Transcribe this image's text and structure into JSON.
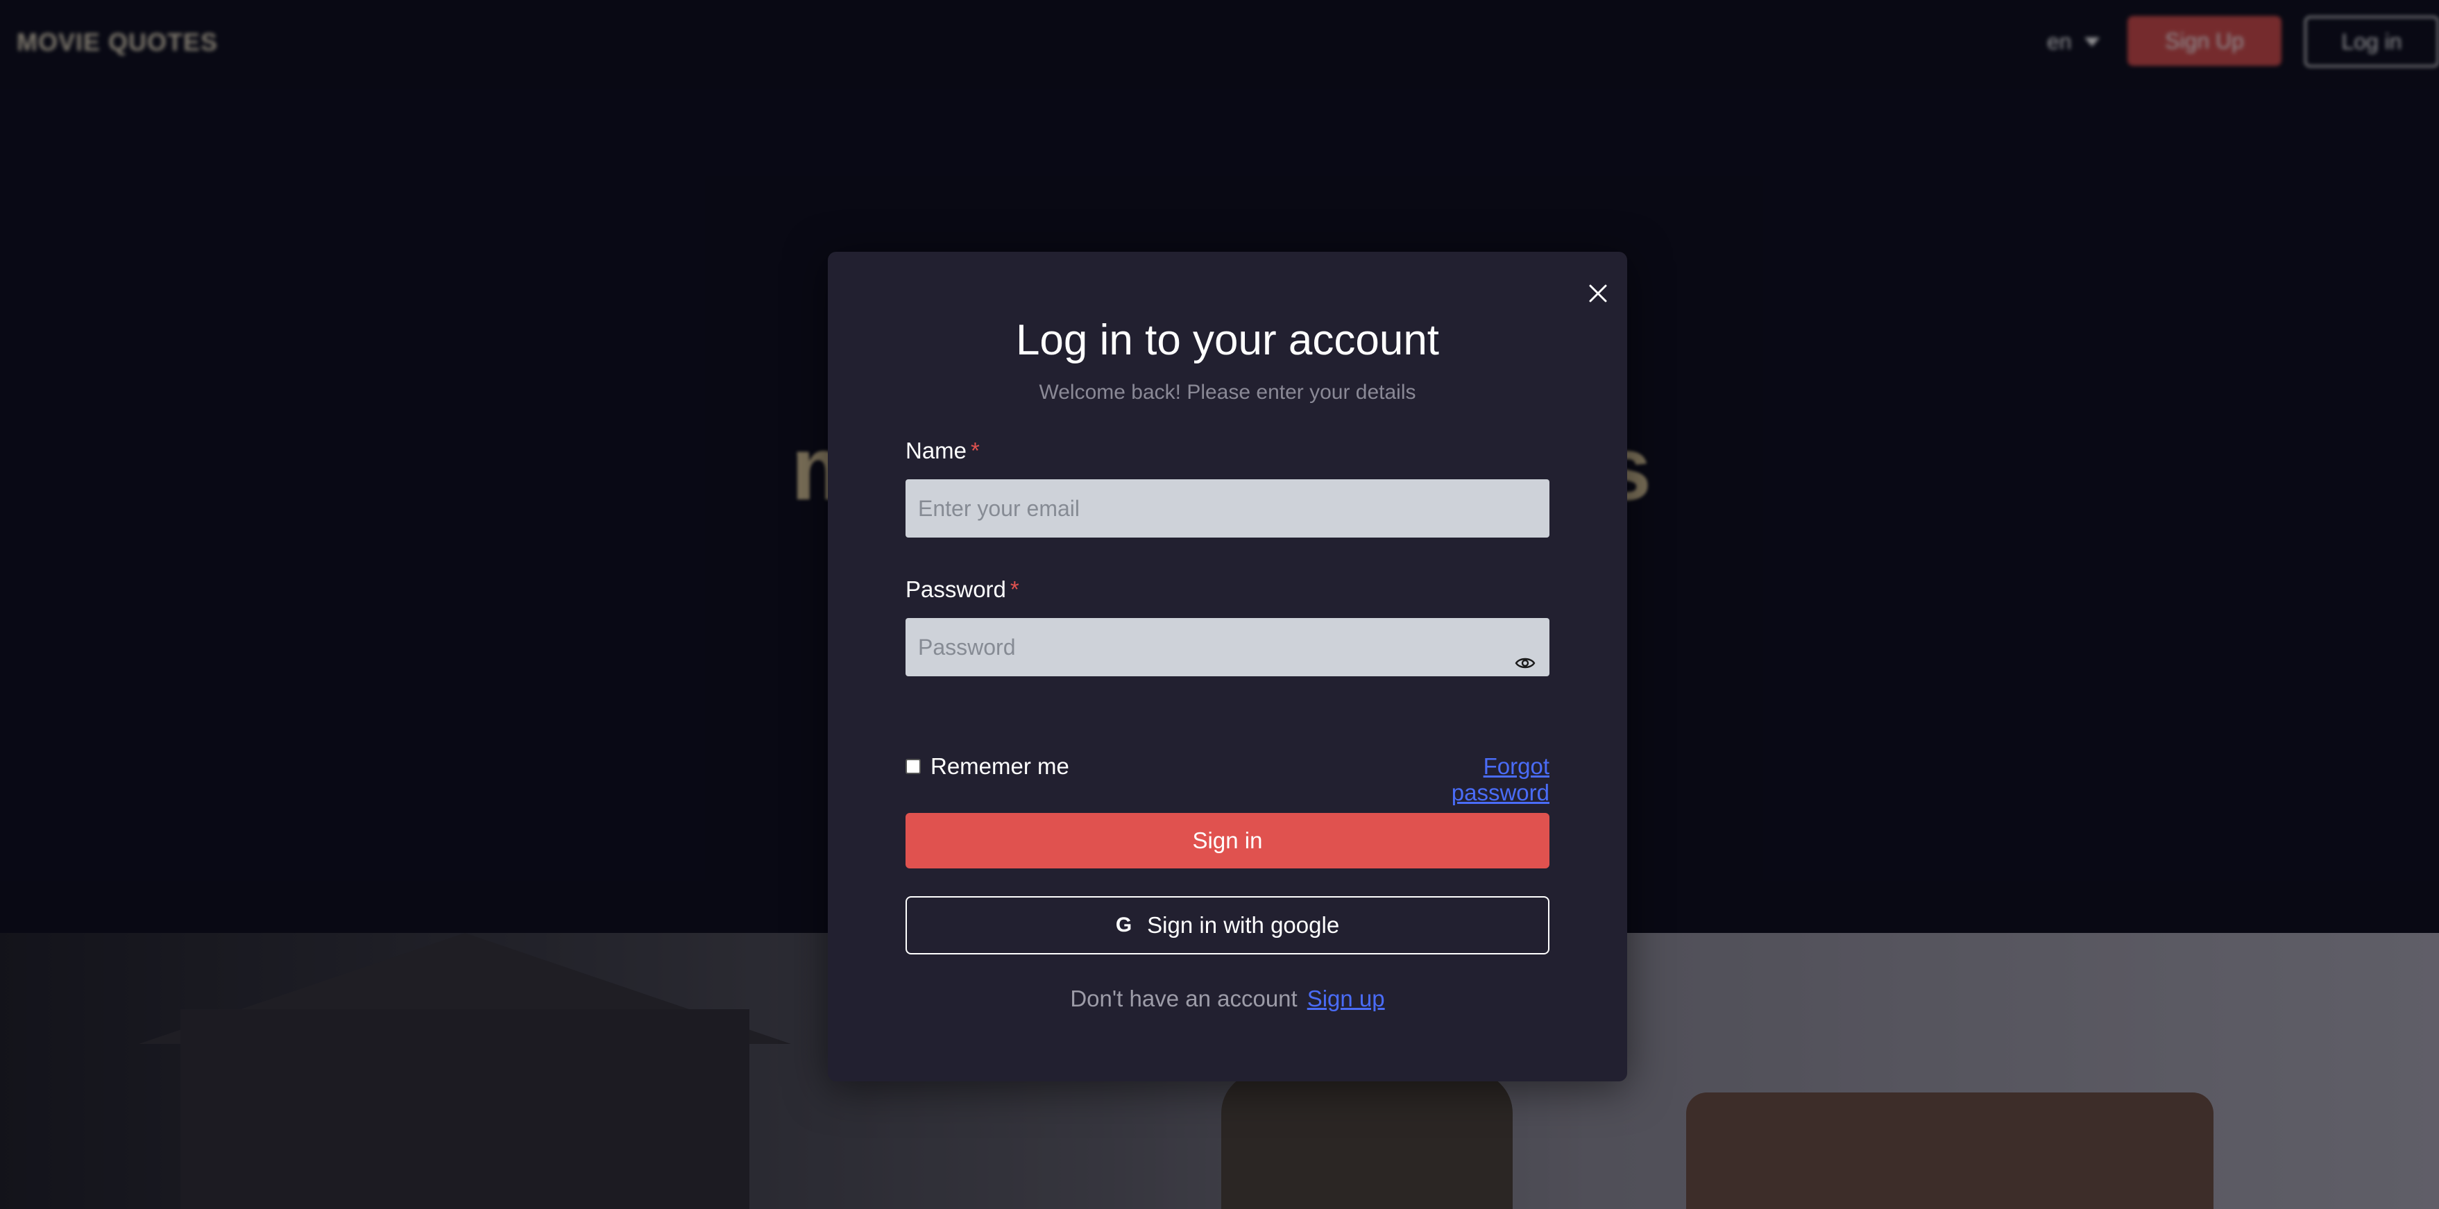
{
  "background": {
    "logo": "MOVIE QUOTES",
    "language": "en",
    "signup_label": "Sign Up",
    "login_label": "Log in"
  },
  "modal": {
    "title": "Log in to your account",
    "subtitle": "Welcome back! Please enter your details",
    "name_label": "Name",
    "name_placeholder": "Enter your email",
    "password_label": "Password",
    "password_placeholder": "Password",
    "required_mark": "*",
    "remember_label": "Rememer me",
    "forgot_label": "Forgot password",
    "signin_label": "Sign in",
    "google_icon_glyph": "G",
    "google_label": "Sign in with google",
    "footer_text": "Don't have an account",
    "footer_link": "Sign up"
  },
  "colors": {
    "accent": "#e0524f",
    "link": "#4a6cf7",
    "modal_bg": "#222030",
    "page_bg": "#0b0c1a",
    "input_bg": "#ced2d9"
  },
  "icons": {
    "close": "close-icon",
    "eye": "eye-icon",
    "google": "google-icon",
    "caret": "caret-down-icon"
  }
}
